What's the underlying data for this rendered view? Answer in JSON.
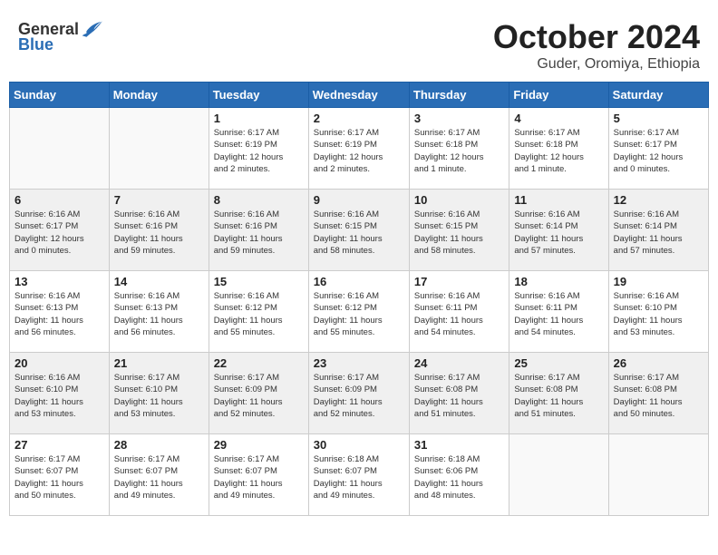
{
  "header": {
    "logo_general": "General",
    "logo_blue": "Blue",
    "month_title": "October 2024",
    "subtitle": "Guder, Oromiya, Ethiopia"
  },
  "weekdays": [
    "Sunday",
    "Monday",
    "Tuesday",
    "Wednesday",
    "Thursday",
    "Friday",
    "Saturday"
  ],
  "weeks": [
    [
      {
        "day": "",
        "info": ""
      },
      {
        "day": "",
        "info": ""
      },
      {
        "day": "1",
        "info": "Sunrise: 6:17 AM\nSunset: 6:19 PM\nDaylight: 12 hours\nand 2 minutes."
      },
      {
        "day": "2",
        "info": "Sunrise: 6:17 AM\nSunset: 6:19 PM\nDaylight: 12 hours\nand 2 minutes."
      },
      {
        "day": "3",
        "info": "Sunrise: 6:17 AM\nSunset: 6:18 PM\nDaylight: 12 hours\nand 1 minute."
      },
      {
        "day": "4",
        "info": "Sunrise: 6:17 AM\nSunset: 6:18 PM\nDaylight: 12 hours\nand 1 minute."
      },
      {
        "day": "5",
        "info": "Sunrise: 6:17 AM\nSunset: 6:17 PM\nDaylight: 12 hours\nand 0 minutes."
      }
    ],
    [
      {
        "day": "6",
        "info": "Sunrise: 6:16 AM\nSunset: 6:17 PM\nDaylight: 12 hours\nand 0 minutes."
      },
      {
        "day": "7",
        "info": "Sunrise: 6:16 AM\nSunset: 6:16 PM\nDaylight: 11 hours\nand 59 minutes."
      },
      {
        "day": "8",
        "info": "Sunrise: 6:16 AM\nSunset: 6:16 PM\nDaylight: 11 hours\nand 59 minutes."
      },
      {
        "day": "9",
        "info": "Sunrise: 6:16 AM\nSunset: 6:15 PM\nDaylight: 11 hours\nand 58 minutes."
      },
      {
        "day": "10",
        "info": "Sunrise: 6:16 AM\nSunset: 6:15 PM\nDaylight: 11 hours\nand 58 minutes."
      },
      {
        "day": "11",
        "info": "Sunrise: 6:16 AM\nSunset: 6:14 PM\nDaylight: 11 hours\nand 57 minutes."
      },
      {
        "day": "12",
        "info": "Sunrise: 6:16 AM\nSunset: 6:14 PM\nDaylight: 11 hours\nand 57 minutes."
      }
    ],
    [
      {
        "day": "13",
        "info": "Sunrise: 6:16 AM\nSunset: 6:13 PM\nDaylight: 11 hours\nand 56 minutes."
      },
      {
        "day": "14",
        "info": "Sunrise: 6:16 AM\nSunset: 6:13 PM\nDaylight: 11 hours\nand 56 minutes."
      },
      {
        "day": "15",
        "info": "Sunrise: 6:16 AM\nSunset: 6:12 PM\nDaylight: 11 hours\nand 55 minutes."
      },
      {
        "day": "16",
        "info": "Sunrise: 6:16 AM\nSunset: 6:12 PM\nDaylight: 11 hours\nand 55 minutes."
      },
      {
        "day": "17",
        "info": "Sunrise: 6:16 AM\nSunset: 6:11 PM\nDaylight: 11 hours\nand 54 minutes."
      },
      {
        "day": "18",
        "info": "Sunrise: 6:16 AM\nSunset: 6:11 PM\nDaylight: 11 hours\nand 54 minutes."
      },
      {
        "day": "19",
        "info": "Sunrise: 6:16 AM\nSunset: 6:10 PM\nDaylight: 11 hours\nand 53 minutes."
      }
    ],
    [
      {
        "day": "20",
        "info": "Sunrise: 6:16 AM\nSunset: 6:10 PM\nDaylight: 11 hours\nand 53 minutes."
      },
      {
        "day": "21",
        "info": "Sunrise: 6:17 AM\nSunset: 6:10 PM\nDaylight: 11 hours\nand 53 minutes."
      },
      {
        "day": "22",
        "info": "Sunrise: 6:17 AM\nSunset: 6:09 PM\nDaylight: 11 hours\nand 52 minutes."
      },
      {
        "day": "23",
        "info": "Sunrise: 6:17 AM\nSunset: 6:09 PM\nDaylight: 11 hours\nand 52 minutes."
      },
      {
        "day": "24",
        "info": "Sunrise: 6:17 AM\nSunset: 6:08 PM\nDaylight: 11 hours\nand 51 minutes."
      },
      {
        "day": "25",
        "info": "Sunrise: 6:17 AM\nSunset: 6:08 PM\nDaylight: 11 hours\nand 51 minutes."
      },
      {
        "day": "26",
        "info": "Sunrise: 6:17 AM\nSunset: 6:08 PM\nDaylight: 11 hours\nand 50 minutes."
      }
    ],
    [
      {
        "day": "27",
        "info": "Sunrise: 6:17 AM\nSunset: 6:07 PM\nDaylight: 11 hours\nand 50 minutes."
      },
      {
        "day": "28",
        "info": "Sunrise: 6:17 AM\nSunset: 6:07 PM\nDaylight: 11 hours\nand 49 minutes."
      },
      {
        "day": "29",
        "info": "Sunrise: 6:17 AM\nSunset: 6:07 PM\nDaylight: 11 hours\nand 49 minutes."
      },
      {
        "day": "30",
        "info": "Sunrise: 6:18 AM\nSunset: 6:07 PM\nDaylight: 11 hours\nand 49 minutes."
      },
      {
        "day": "31",
        "info": "Sunrise: 6:18 AM\nSunset: 6:06 PM\nDaylight: 11 hours\nand 48 minutes."
      },
      {
        "day": "",
        "info": ""
      },
      {
        "day": "",
        "info": ""
      }
    ]
  ]
}
